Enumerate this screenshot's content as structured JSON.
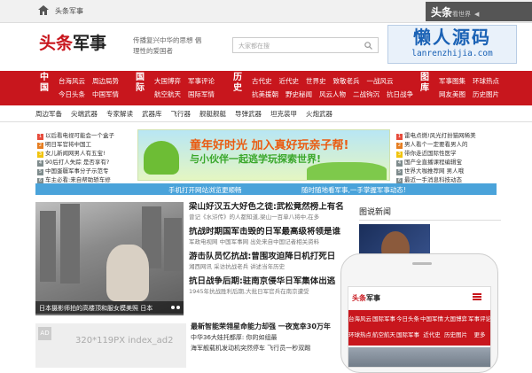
{
  "topbar": {
    "breadcrumb": "头条军事",
    "badge_main": "头条",
    "badge_sub": "看世界",
    "badge_arrow": "◀"
  },
  "header": {
    "logo_red": "头条",
    "logo_black": "军事",
    "slogan": "传播复兴中华的思想 倡理性的爱国者",
    "search_placeholder": "大家都在搜",
    "watermark_cn": "懒人源码",
    "watermark_en": "lanrenzhijia.com"
  },
  "nav": {
    "groups": [
      {
        "label": "中国",
        "row1": [
          "台海风云",
          "周边局势"
        ],
        "row2": [
          "今日头条",
          "中国军情"
        ]
      },
      {
        "label": "国际",
        "row1": [
          "大国博弈",
          "军事评论"
        ],
        "row2": [
          "航空航天",
          "国际军情"
        ]
      },
      {
        "label": "历史",
        "row1": [
          "古代史",
          "近代史",
          "世界史",
          "致敬老兵",
          "一战风云"
        ],
        "row2": [
          "抗美援朝",
          "野史秘闻",
          "风云人物",
          "二战钩沉",
          "抗日战争"
        ]
      },
      {
        "label": "图库",
        "row1": [
          "军事图集",
          "环球热点"
        ],
        "row2": [
          "网友美图",
          "历史图片"
        ]
      }
    ]
  },
  "subnav": [
    "周边军备",
    "尖端武器",
    "专家解读",
    "武器库",
    "飞行器",
    "舰艇舰艇",
    "导弹武器",
    "坦克装甲",
    "火炮武器"
  ],
  "news_left": [
    {
      "n": "1",
      "c": "#e74c3c",
      "t": "以后看电视可能会一个盒子"
    },
    {
      "n": "2",
      "c": "#e67e22",
      "t": "明日军官将中国工"
    },
    {
      "n": "3",
      "c": "#f1c40f",
      "t": "女儿新闻网男人有五宝!"
    },
    {
      "n": "4",
      "c": "#7f8c8d",
      "t": "90后打人失踪 是否享有?"
    },
    {
      "n": "5",
      "c": "#7f8c8d",
      "t": "中国蛋疆军事分子示范专"
    },
    {
      "n": "6",
      "c": "#7f8c8d",
      "t": "车主必看:来自帮助轿车修"
    }
  ],
  "banner": {
    "line1": "童年好时光 加入真好玩亲子帮!",
    "line2": "与小伙伴一起逃学玩探索世界!"
  },
  "news_right": [
    {
      "n": "1",
      "c": "#e74c3c",
      "t": "雷电点燃!风光打扮猫网稀美"
    },
    {
      "n": "2",
      "c": "#e67e22",
      "t": "男人看个一定要看男人的"
    },
    {
      "n": "3",
      "c": "#f1c40f",
      "t": "带你走近国际性医学"
    },
    {
      "n": "4",
      "c": "#7f8c8d",
      "t": "国产全直播课程编辑宝"
    },
    {
      "n": "5",
      "c": "#7f8c8d",
      "t": "世界大咖推荐网 男人哦"
    },
    {
      "n": "6",
      "c": "#7f8c8d",
      "t": "最近一手消息科技动态"
    }
  ],
  "strip": {
    "left": "手机打开网站浏览更顺畅",
    "right": "随时随地看军事,一手掌握军事动态!"
  },
  "feature": {
    "caption": "日本摄影师拍的高楼顶和服女模美照 日本"
  },
  "headlines": [
    {
      "t": "梁山好汉五大好色之徒:武松竟然榜上有名",
      "d": "曾记《水浒传》的人都知道,梁山一百单八将中,在多"
    },
    {
      "t": "抗战时期国军击毁的日军最高级将领是谁",
      "d": "军政电视网 中国军事网 出处来自中国记者相关资料"
    },
    {
      "t": "游击队员忆抗战:曾围攻迫降日机打死日",
      "d": "湘西网讯 采访抗战老兵 讲述当年历史"
    },
    {
      "t": "抗日战争后期:驻南京侵华日军集体出逃",
      "d": "1945年抗战胜利后期,大批日军官兵在南京遭受"
    }
  ],
  "ad": {
    "label": "AD",
    "text": "320*119PX index_ad2"
  },
  "list2": [
    "最新智能荣翎星命能力却强 一夜宽幸30万年",
    "中华36大娃托都厚: 你的如组最",
    "海军舰载机发动机突然停车 飞行员一秒双踢"
  ],
  "gallery": {
    "title": "图说新闻"
  },
  "phone": {
    "logo_red": "头条",
    "logo_black": "军事",
    "nav": [
      "台海风云",
      "国际军事",
      "今日头条",
      "中国军情",
      "大国博弈",
      "军事评论",
      "环球热点",
      "航空航天",
      "国际军事",
      "近代史",
      "历史图片",
      "更多"
    ]
  }
}
